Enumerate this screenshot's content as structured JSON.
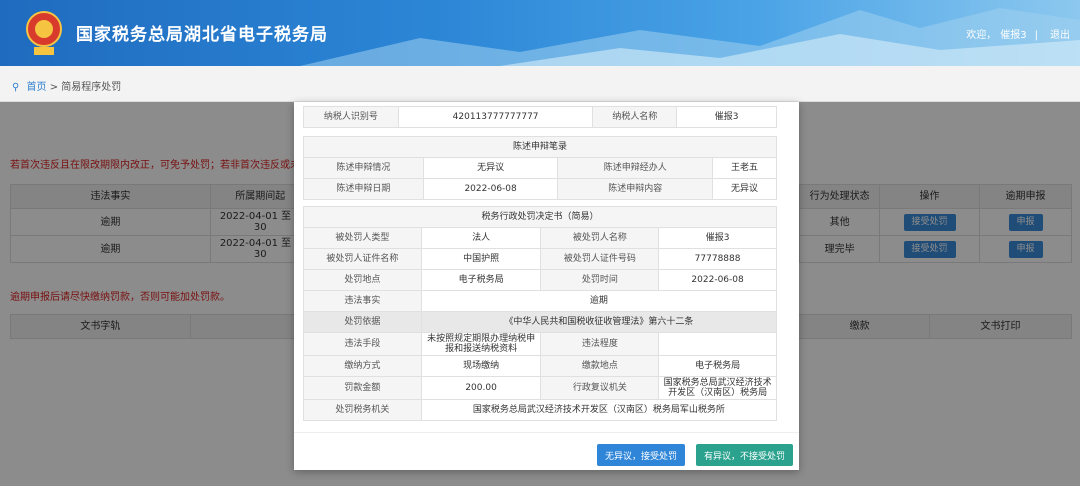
{
  "header": {
    "title": "国家税务总局湖北省电子税务局",
    "welcome": "欢迎，",
    "username": "催报3",
    "logout": "退出"
  },
  "breadcrumb": {
    "home": "首页",
    "separator": ">",
    "current": "简易程序处罚"
  },
  "background": {
    "warning1": "若首次违反且在限改期限内改正，可免予处罚；若非首次违反或未在期限",
    "table1": {
      "headers": [
        "违法事实",
        "所属期间起",
        "",
        "",
        "",
        "行为处理状态",
        "操作",
        "逾期申报"
      ],
      "rows": [
        {
          "fact": "逾期",
          "period": "2022-04-01 至 2",
          "period2": "30",
          "status": "其他",
          "op": "接受处罚",
          "declare": "申报"
        },
        {
          "fact": "逾期",
          "period": "2022-04-01 至 2",
          "period2": "30",
          "status": "理完毕",
          "op": "接受处罚",
          "declare": "申报"
        }
      ]
    },
    "warning2": "逾期申报后请尽快缴纳罚款，否则可能加处罚款。",
    "table2": {
      "headers": [
        "文书字轨",
        "",
        "",
        "缴款",
        "文书打印"
      ]
    }
  },
  "modal": {
    "taxpayer": {
      "id_label": "纳税人识别号",
      "id_value": "420113777777777",
      "name_label": "纳税人名称",
      "name_value": "催报3"
    },
    "statement": {
      "title": "陈述申辩笔录",
      "situation_label": "陈述申辩情况",
      "situation_value": "无异议",
      "handler_label": "陈述申辩经办人",
      "handler_value": "王老五",
      "date_label": "陈述申辩日期",
      "date_value": "2022-06-08",
      "content_label": "陈述申辩内容",
      "content_value": "无异议"
    },
    "decision": {
      "title": "税务行政处罚决定书（简易）",
      "type_label": "被处罚人类型",
      "type_value": "法人",
      "pname_label": "被处罚人名称",
      "pname_value": "催报3",
      "cert_label": "被处罚人证件名称",
      "cert_value": "中国护照",
      "certno_label": "被处罚人证件号码",
      "certno_value": "77778888",
      "place_label": "处罚地点",
      "place_value": "电子税务局",
      "time_label": "处罚时间",
      "time_value": "2022-06-08",
      "fact_label": "违法事实",
      "fact_value": "逾期",
      "basis_label": "处罚依据",
      "basis_value": "《中华人民共和国税收征收管理法》第六十二条",
      "means_label": "违法手段",
      "means_value": "未按照规定期限办理纳税申报和报送纳税资料",
      "degree_label": "违法程度",
      "degree_value": "",
      "pay_method_label": "缴纳方式",
      "pay_method_value": "现场缴纳",
      "pay_place_label": "缴款地点",
      "pay_place_value": "电子税务局",
      "amount_label": "罚款金额",
      "amount_value": "200.00",
      "review_label": "行政复议机关",
      "review_value": "国家税务总局武汉经济技术开发区（汉南区）税务局",
      "org_label": "处罚税务机关",
      "org_value": "国家税务总局武汉经济技术开发区（汉南区）税务局军山税务所"
    },
    "buttons": {
      "accept": "无异议，接受处罚",
      "reject": "有异议，不接受处罚"
    }
  },
  "colors": {
    "header_blue": "#2c86d6",
    "accept_button": "#2f86d8",
    "reject_button": "#2aa28e",
    "warning_red": "#dd2222"
  }
}
